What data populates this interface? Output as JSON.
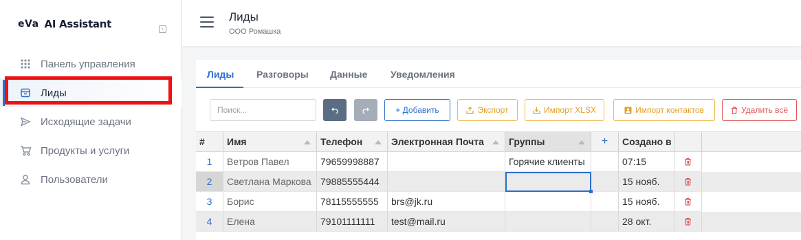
{
  "app": {
    "logo_text": "eVa",
    "name": "AI Assistant",
    "collapse_icon": "collapse-sidebar-icon"
  },
  "sidebar": {
    "items": [
      {
        "label": "Панель управления",
        "icon": "grid-dots-icon",
        "active": false
      },
      {
        "label": "Лиды",
        "icon": "inbox-icon",
        "active": true
      },
      {
        "label": "Исходящие задачи",
        "icon": "send-icon",
        "active": false
      },
      {
        "label": "Продукты и услуги",
        "icon": "cart-icon",
        "active": false
      },
      {
        "label": "Пользователи",
        "icon": "user-icon",
        "active": false
      }
    ]
  },
  "header": {
    "title": "Лиды",
    "subtitle": "ООО Ромашка"
  },
  "tabs": [
    {
      "label": "Лиды",
      "active": true
    },
    {
      "label": "Разговоры",
      "active": false
    },
    {
      "label": "Данные",
      "active": false
    },
    {
      "label": "Уведомления",
      "active": false
    }
  ],
  "toolbar": {
    "search_placeholder": "Поиск...",
    "add_label": "+ Добавить",
    "export_label": "Экспорт",
    "import_xlsx_label": "Импорт XLSX",
    "import_contacts_label": "Импорт контактов",
    "delete_all_label": "Удалить всё"
  },
  "table": {
    "columns": [
      "#",
      "Имя",
      "Телефон",
      "Электронная Почта",
      "Группы",
      "+",
      "Создано в"
    ],
    "rows": [
      {
        "idx": "1",
        "name": "Ветров Павел",
        "phone": "79659998887",
        "email": "",
        "group": "Горячие клиенты",
        "created": "07:15"
      },
      {
        "idx": "2",
        "name": "Светлана Маркова",
        "phone": "79885555444",
        "email": "",
        "group": "",
        "created": "15 нояб."
      },
      {
        "idx": "3",
        "name": "Борис",
        "phone": "78115555555",
        "email": "brs@jk.ru",
        "group": "",
        "created": "15 нояб."
      },
      {
        "idx": "4",
        "name": "Елена",
        "phone": "79101111111",
        "email": "test@mail.ru",
        "group": "",
        "created": "28 окт."
      }
    ]
  },
  "colors": {
    "accent": "#2c6ecb",
    "warning": "#f0b84a",
    "danger": "#e05555",
    "highlight": "#ee1111"
  }
}
